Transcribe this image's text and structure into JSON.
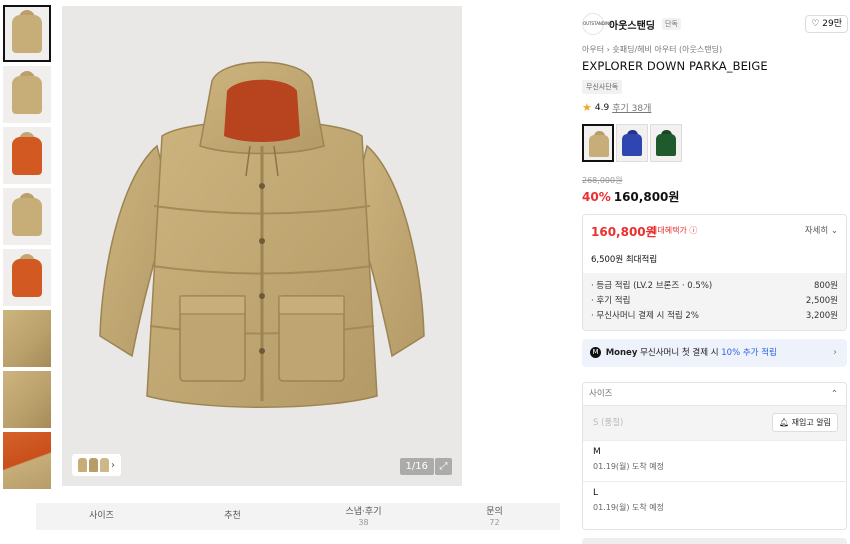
{
  "gallery": {
    "thumbnails": [
      "front",
      "front",
      "hood-open",
      "back",
      "hood-detail",
      "side",
      "detail",
      "lining"
    ],
    "counter": "1/16",
    "expand_icon": "expand-icon"
  },
  "tabs": [
    {
      "label": "사이즈",
      "count": ""
    },
    {
      "label": "추천",
      "count": ""
    },
    {
      "label": "스냅·후기",
      "count": "38"
    },
    {
      "label": "문의",
      "count": "72"
    }
  ],
  "brand": {
    "logo_text": "OUTSTANDING",
    "name": "아웃스탠딩",
    "exclusive_badge": "단독",
    "likes": "29만"
  },
  "breadcrumb": {
    "first": "아우터",
    "second": "숏패딩/헤비 아우터 (아웃스탠딩)"
  },
  "product": {
    "title": "EXPLORER DOWN PARKA_BEIGE",
    "tag": "무신사단독",
    "rating": "4.9",
    "reviews": "후기 38개",
    "colors": [
      "#c7ae79",
      "#2f46b0",
      "#1f5a2c"
    ]
  },
  "price": {
    "original": "268,000원",
    "discount": "40%",
    "current": "160,800원"
  },
  "benefit": {
    "price": "160,800원",
    "max_label": "최대혜택가",
    "detail_label": "자세히",
    "point_summary": "6,500원 최대적립",
    "rows": [
      {
        "label": "· 등급 적립 (LV.2 브론즈 · 0.5%)",
        "value": "800원"
      },
      {
        "label": "· 후기 적립",
        "value": "2,500원"
      },
      {
        "label": "· 무신사머니 결제 시 적립 2%",
        "value": "3,200원"
      }
    ]
  },
  "money": {
    "icon": "M",
    "brand": "Money",
    "text": "무신사머니 첫 결제 시",
    "highlight": "10% 추가 적립"
  },
  "size": {
    "header": "사이즈",
    "soldout": "S (품절)",
    "restock_label": "재입고 알림",
    "options": [
      {
        "name": "M",
        "delivery": "01.19(월) 도착 예정"
      },
      {
        "name": "L",
        "delivery": "01.19(월) 도착 예정"
      }
    ]
  }
}
